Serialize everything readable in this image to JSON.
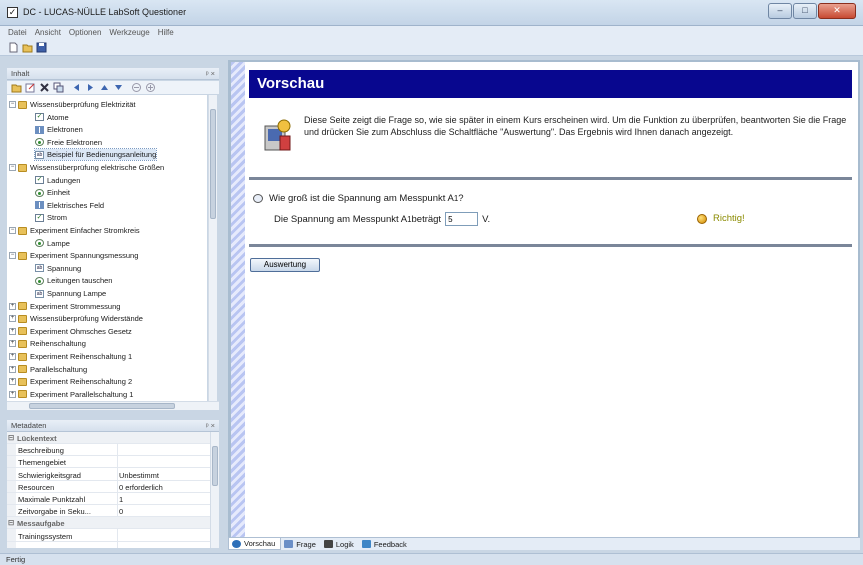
{
  "window": {
    "title": "DC - LUCAS-NÜLLE LabSoft Questioner",
    "controls": [
      "–",
      "□",
      "✕"
    ]
  },
  "menu": [
    "Datei",
    "Ansicht",
    "Optionen",
    "Werkzeuge",
    "Hilfe"
  ],
  "panels": {
    "content": {
      "title": "Inhalt",
      "pin": "ᵖ ×"
    },
    "metadata": {
      "title": "Metadaten",
      "pin": "ᵖ ×"
    }
  },
  "tree": [
    {
      "label": "Wissensüberprüfung Elektrizität",
      "type": "folder",
      "level": 0,
      "expander": "−"
    },
    {
      "label": "Atome",
      "type": "check",
      "level": 1
    },
    {
      "label": "Elektronen",
      "type": "match",
      "level": 1
    },
    {
      "label": "Freie Elektronen",
      "type": "radio",
      "level": 1
    },
    {
      "label": "Beispiel für Bedienungsanleitung",
      "type": "fill",
      "level": 1,
      "selected": true
    },
    {
      "label": "Wissensüberprüfung elektrische Größen",
      "type": "folder",
      "level": 0,
      "expander": "−"
    },
    {
      "label": "Ladungen",
      "type": "check",
      "level": 1
    },
    {
      "label": "Einheit",
      "type": "radio",
      "level": 1
    },
    {
      "label": "Elektrisches Feld",
      "type": "match",
      "level": 1
    },
    {
      "label": "Strom",
      "type": "check",
      "level": 1
    },
    {
      "label": "Experiment Einfacher Stromkreis",
      "type": "folder",
      "level": 0,
      "expander": "−"
    },
    {
      "label": "Lampe",
      "type": "radio",
      "level": 1
    },
    {
      "label": "Experiment Spannungsmessung",
      "type": "folder",
      "level": 0,
      "expander": "−"
    },
    {
      "label": "Spannung",
      "type": "fill",
      "level": 1
    },
    {
      "label": "Leitungen tauschen",
      "type": "radio",
      "level": 1
    },
    {
      "label": "Spannung Lampe",
      "type": "fill",
      "level": 1
    },
    {
      "label": "Experiment Strommessung",
      "type": "folder",
      "level": 0,
      "expander": "+"
    },
    {
      "label": "Wissensüberprüfung Widerstände",
      "type": "folder",
      "level": 0,
      "expander": "+"
    },
    {
      "label": "Experiment Ohmsches Gesetz",
      "type": "folder",
      "level": 0,
      "expander": "+"
    },
    {
      "label": "Reihenschaltung",
      "type": "folder",
      "level": 0,
      "expander": "+"
    },
    {
      "label": "Experiment Reihenschaltung 1",
      "type": "folder",
      "level": 0,
      "expander": "+"
    },
    {
      "label": "Parallelschaltung",
      "type": "folder",
      "level": 0,
      "expander": "+"
    },
    {
      "label": "Experiment Reihenschaltung 2",
      "type": "folder",
      "level": 0,
      "expander": "+"
    },
    {
      "label": "Experiment Parallelschaltung 1",
      "type": "folder",
      "level": 0,
      "expander": "+"
    }
  ],
  "metadata": [
    {
      "cat": true,
      "key": "Lückentext",
      "value": ""
    },
    {
      "key": "Beschreibung",
      "value": ""
    },
    {
      "key": "Themengebiet",
      "value": ""
    },
    {
      "key": "Schwierigkeitsgrad",
      "value": "Unbestimmt"
    },
    {
      "key": "Resourcen",
      "value": "0 erforderlich"
    },
    {
      "key": "Maximale Punktzahl",
      "value": "1"
    },
    {
      "key": "Zeitvorgabe in Seku...",
      "value": "0"
    },
    {
      "cat": true,
      "key": "Messaufgabe",
      "value": ""
    },
    {
      "key": "Trainingssystem",
      "value": ""
    }
  ],
  "preview": {
    "header": "Vorschau",
    "intro": "Diese Seite zeigt die Frage so, wie sie später in einem Kurs erscheinen wird. Um die Funktion zu überprüfen, beantworten Sie die Frage und drücken Sie zum Abschluss die Schaltfläche \"Auswertung\". Das Ergebnis wird Ihnen danach angezeigt.",
    "question_prefix": "Wie groß ist die Spannung am Messpunkt A",
    "question_sub": "1",
    "question_suffix": "?",
    "answer_prefix": "Die Spannung am Messpunkt A",
    "answer_sub": "1",
    "answer_mid": " beträgt",
    "answer_value": "5",
    "answer_unit": "V.",
    "result": "Richtig!",
    "evaluate_button": "Auswertung"
  },
  "tabs": [
    {
      "label": "Vorschau",
      "icon": "preview-icon",
      "active": true
    },
    {
      "label": "Frage",
      "icon": "question-icon",
      "active": false
    },
    {
      "label": "Logik",
      "icon": "function-icon",
      "active": false
    },
    {
      "label": "Feedback",
      "icon": "feedback-icon",
      "active": false
    }
  ],
  "status": "Fertig",
  "colors": {
    "header_bg": "#08078f",
    "accent": "#a8bccf",
    "result": "#8b8b00"
  }
}
